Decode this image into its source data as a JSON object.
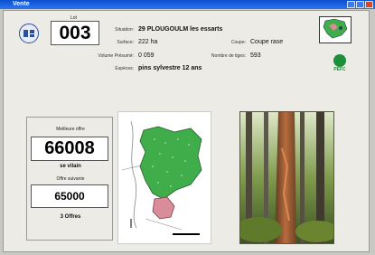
{
  "window": {
    "title": "Vente"
  },
  "lot": {
    "label": "Lot",
    "number": "003"
  },
  "info": [
    {
      "label": "Situation:",
      "value": "29 PLOUGOULM les essarts"
    },
    {
      "label": "Surface:",
      "value": "222 ha"
    },
    {
      "label": "Volume Présumé:",
      "value": "0 059"
    },
    {
      "label": "Espèces:",
      "value": "pins sylvestre 12 ans"
    }
  ],
  "info_right": [
    {
      "label": "Coupe:",
      "value": "Coupe rase"
    },
    {
      "label": "Nombre de tiges:",
      "value": "593"
    }
  ],
  "certification": {
    "label": "PEFC"
  },
  "bids": {
    "best_label": "Meilleure offre",
    "best_value": "66008",
    "best_bidder": "se vilain",
    "next_label": "Offre suivante",
    "next_value": "65000",
    "count_text": "3 Offres"
  },
  "colors": {
    "title_bar": "#1a5fe0",
    "map_green": "#3fae4a",
    "map_pink": "#d98c9a",
    "panel_bg": "#ecebe6"
  }
}
